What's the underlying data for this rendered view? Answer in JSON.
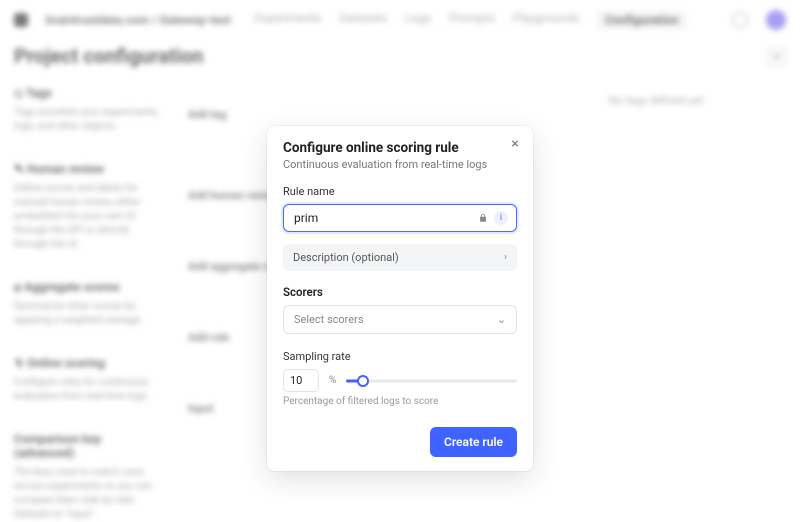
{
  "topbar": {
    "breadcrumb": "braintrustdata.com / Gateway-test",
    "tabs": [
      "Experiments",
      "Datasets",
      "Logs",
      "Prompts",
      "Playgrounds",
      "Configuration"
    ],
    "active_tab_index": 5
  },
  "page": {
    "title": "Project configuration",
    "hint": "No tags defined yet",
    "plus": "+",
    "sections": [
      {
        "title": "◇ Tags",
        "desc": "Tags annotate your experiments, logs, and other objects."
      },
      {
        "title": "✎ Human review",
        "desc": "Define scores and labels for manual human review, either embedded into your own UI through the API or directly through the UI."
      },
      {
        "title": "⌀ Aggregate scores",
        "desc": "Summarize other scores by applying a weighted average."
      },
      {
        "title": "↯ Online scoring",
        "desc": "Configure rules for continuous evaluation from real-time logs."
      },
      {
        "title": "Comparison key (advanced)",
        "desc": "The keys used to match rows across experiments so you can compare them side by side. Defaults to \"input\"."
      }
    ],
    "mid_rows": [
      "Add tag",
      "Add human review score",
      "Add aggregate score",
      "Add rule",
      "Input"
    ],
    "mid_extra": "None"
  },
  "modal": {
    "title": "Configure online scoring rule",
    "subtitle": "Continuous evaluation from real-time logs",
    "rule_name_label": "Rule name",
    "rule_name_value": "prim",
    "desc_label": "Description (optional)",
    "scorers_title": "Scorers",
    "scorers_placeholder": "Select scorers",
    "sampling_label": "Sampling rate",
    "sampling_value": "10",
    "pct": "%",
    "sampling_help": "Percentage of filtered logs to score",
    "submit": "Create rule",
    "close": "×",
    "colors": {
      "accent": "#3e63ff"
    },
    "slider_pct": 10
  }
}
